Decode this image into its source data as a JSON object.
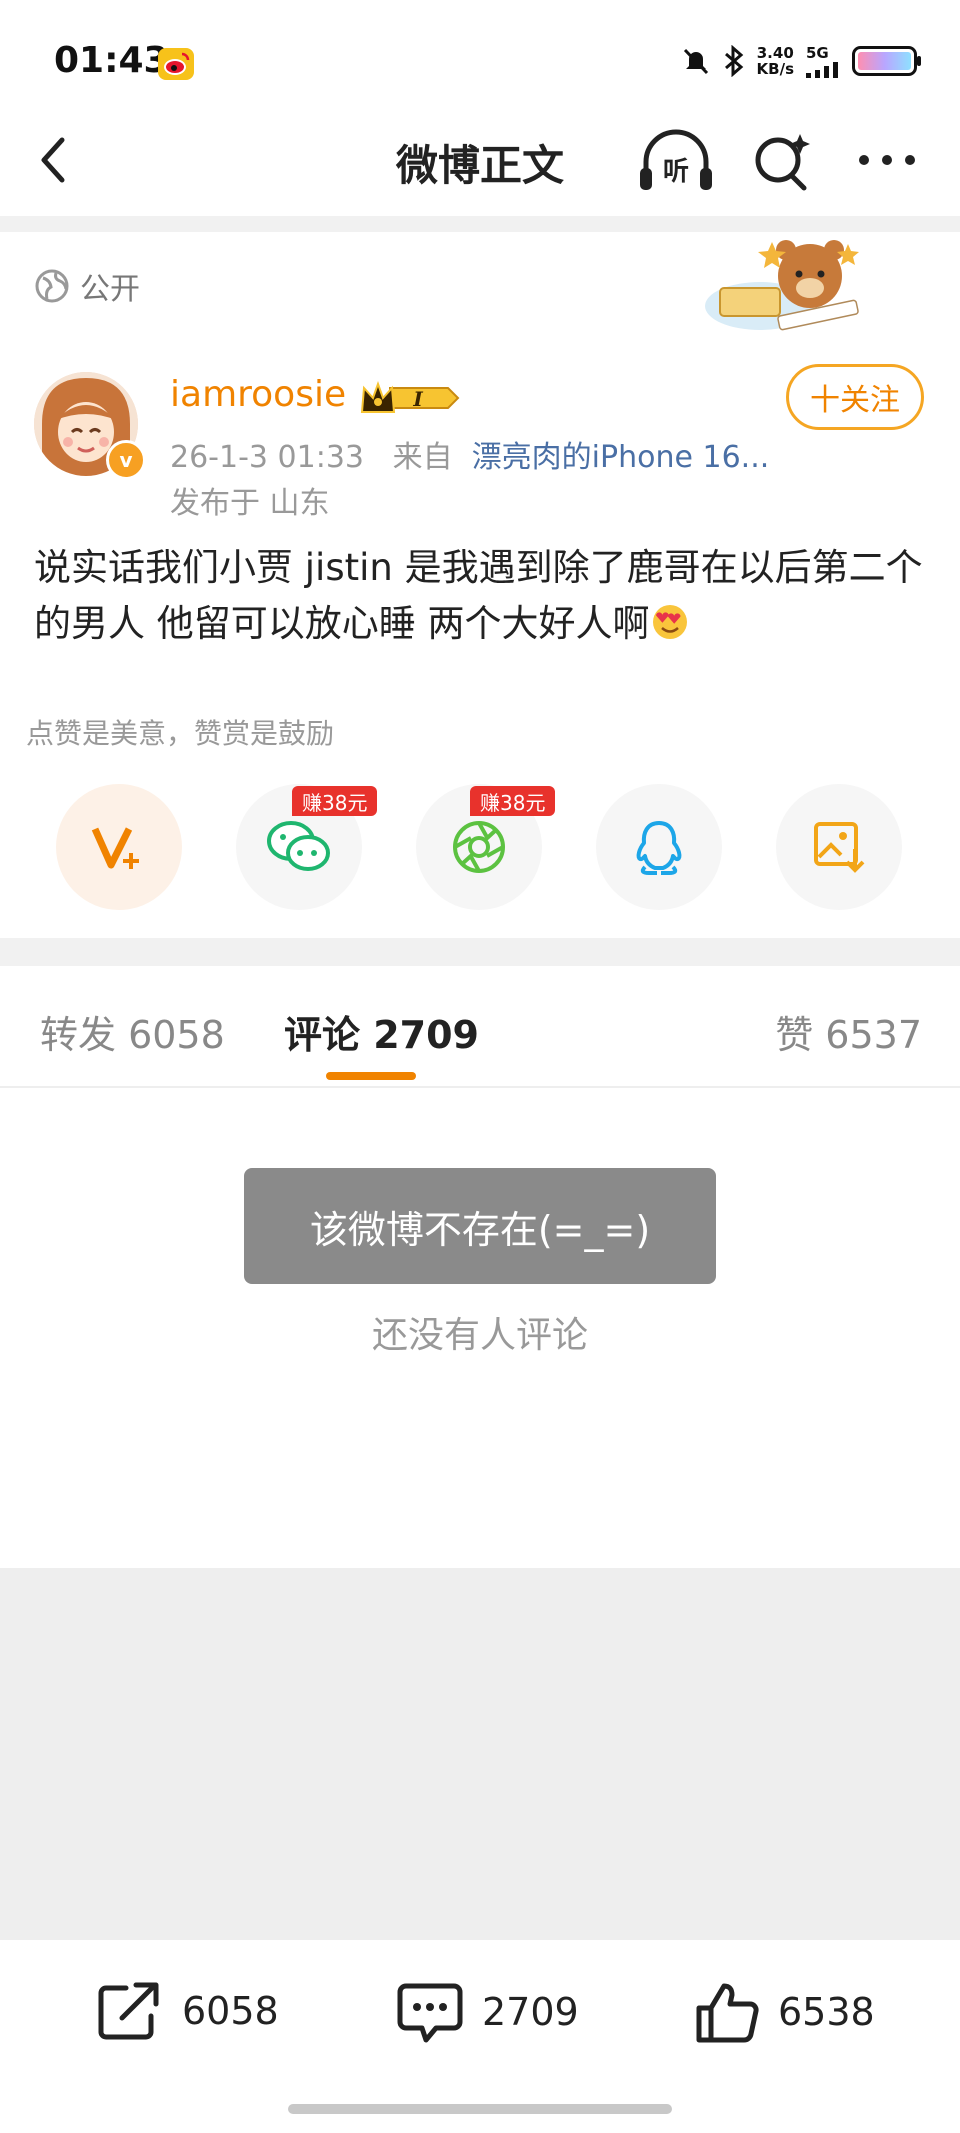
{
  "status_bar": {
    "time": "01:43",
    "net_speed_value": "3.40",
    "net_speed_unit": "KB/s",
    "network_type": "5G",
    "icons": [
      "weibo-app-icon",
      "mute-icon",
      "bluetooth-icon",
      "signal-icon",
      "battery-icon"
    ]
  },
  "nav": {
    "title": "微博正文",
    "listen_label": "听",
    "icons": [
      "back-icon",
      "listen-icon",
      "search-icon",
      "more-icon"
    ]
  },
  "post": {
    "visibility": "公开",
    "username": "iamroosie",
    "vip_label": "I",
    "verified_mark": "v",
    "date": "26-1-3 01:33",
    "source_prefix": "来自",
    "source": "漂亮肉的iPhone 16...",
    "location": "发布于 山东",
    "follow_label": "十关注",
    "text": "说实话我们小贾 jistin 是我遇到除了鹿哥在以后第二个的男人 他留可以放心睡 两个大好人啊"
  },
  "share": {
    "hint": "点赞是美意，赞赏是鼓励",
    "earn_tag_wechat": "赚38元",
    "earn_tag_moments": "赚38元",
    "icons": [
      "vplus-icon",
      "wechat-icon",
      "moments-icon",
      "qq-icon",
      "save-image-icon"
    ]
  },
  "tabs": {
    "repost": "转发 6058",
    "comment": "评论 2709",
    "like": "赞 6537"
  },
  "comments": {
    "toast": "该微博不存在(=_=)",
    "empty": "还没有人评论"
  },
  "toolbar": {
    "repost_count": "6058",
    "comment_count": "2709",
    "like_count": "6538"
  },
  "colors": {
    "accent": "#f08300",
    "follow_border": "#f5a623",
    "source_link": "#4a6fa5",
    "earn_tag": "#e8322c"
  }
}
